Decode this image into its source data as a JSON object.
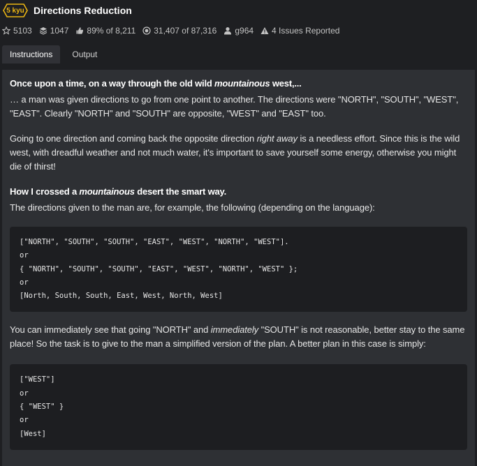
{
  "kata": {
    "rank": "5 kyu",
    "title": "Directions Reduction"
  },
  "stats": {
    "stars": "5103",
    "collections": "1047",
    "satisfaction": "89% of 8,211",
    "completed": "31,407 of 87,316",
    "author": "g964",
    "issues": "4 Issues Reported"
  },
  "tabs": {
    "instructions": "Instructions",
    "output": "Output"
  },
  "description": {
    "heading1_a": "Once upon a time, on a way through the old wild ",
    "heading1_em": "mountainous",
    "heading1_b": " west,...",
    "p1": "… a man was given directions to go from one point to another. The directions were \"NORTH\", \"SOUTH\", \"WEST\", \"EAST\". Clearly \"NORTH\" and \"SOUTH\" are opposite, \"WEST\" and \"EAST\" too.",
    "p2_a": "Going to one direction and coming back the opposite direction ",
    "p2_em": "right away",
    "p2_b": " is a needless effort. Since this is the wild west, with dreadful weather and not much water, it's important to save yourself some energy, otherwise you might die of thirst!",
    "heading2_a": "How I crossed a ",
    "heading2_em": "mountainous",
    "heading2_b": " desert the smart way.",
    "p3": "The directions given to the man are, for example, the following (depending on the language):",
    "code1": "[\"NORTH\", \"SOUTH\", \"SOUTH\", \"EAST\", \"WEST\", \"NORTH\", \"WEST\"].\nor\n{ \"NORTH\", \"SOUTH\", \"SOUTH\", \"EAST\", \"WEST\", \"NORTH\", \"WEST\" };\nor\n[North, South, South, East, West, North, West]",
    "p4_a": "You can immediately see that going \"NORTH\" and ",
    "p4_em": "immediately",
    "p4_b": " \"SOUTH\" is not reasonable, better stay to the same place! So the task is to give to the man a simplified version of the plan. A better plan in this case is simply:",
    "code2": "[\"WEST\"]\nor\n{ \"WEST\" }\nor\n[West]"
  },
  "colors": {
    "rank_accent": "#ecb613",
    "background": "#1e1f22",
    "panel": "#2e3034",
    "code_bg": "#1d1e21"
  },
  "icons": [
    "hexagon-badge",
    "star-icon",
    "layers-icon",
    "thumbs-icon",
    "target-icon",
    "user-icon",
    "warning-icon"
  ]
}
